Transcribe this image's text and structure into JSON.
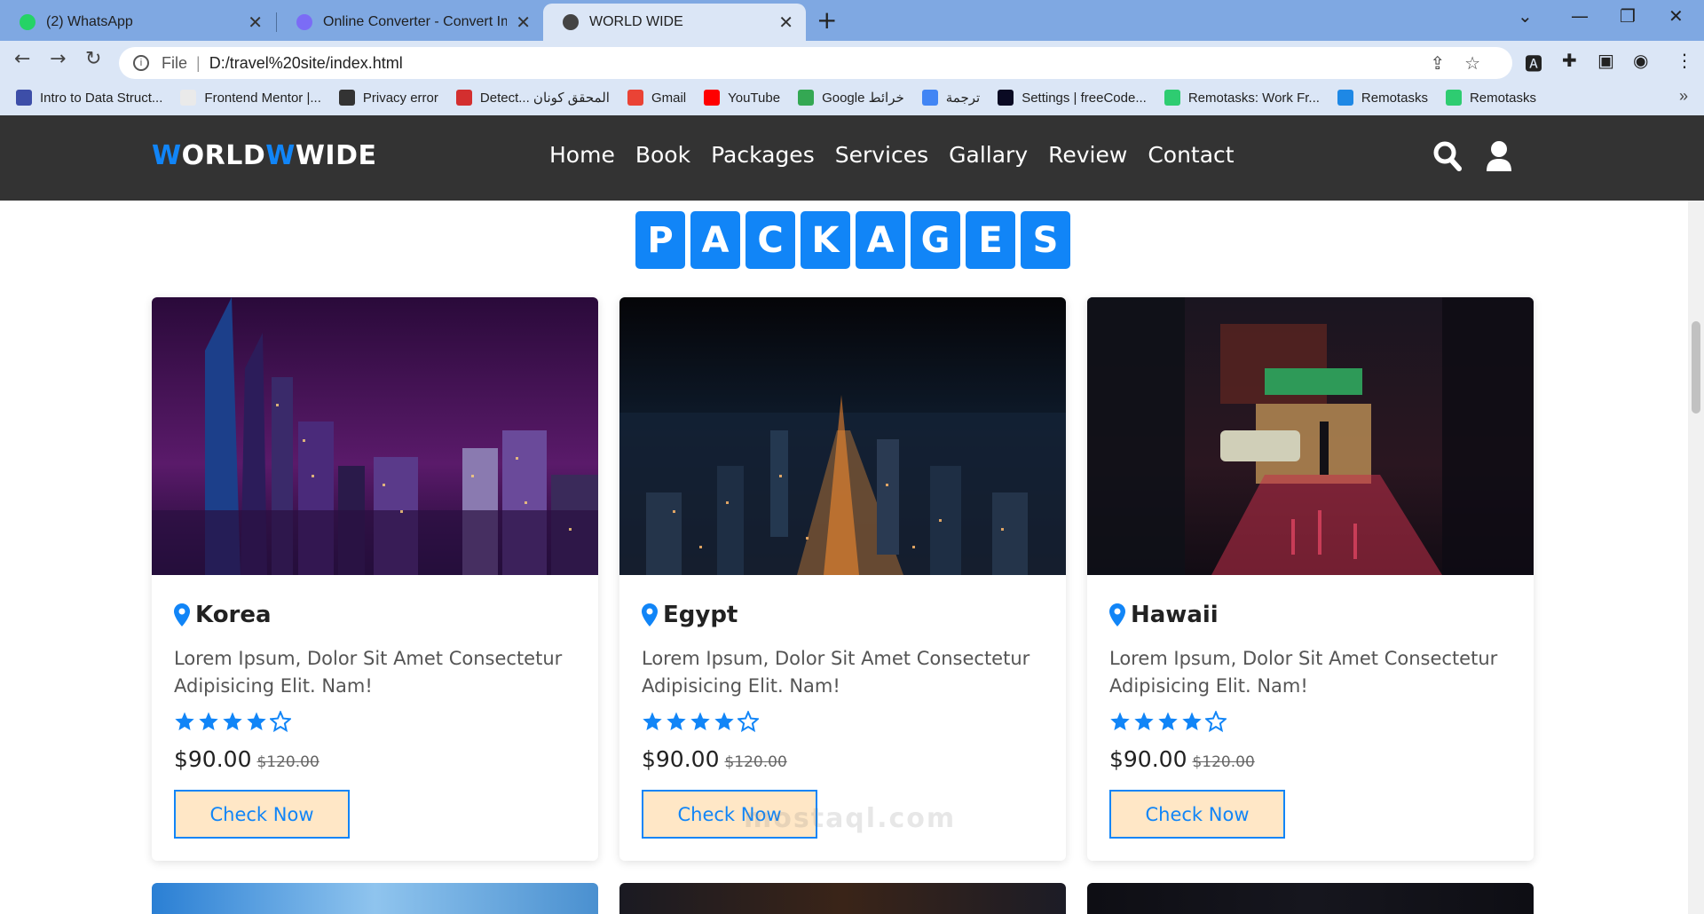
{
  "browser": {
    "tabs": [
      {
        "title": "(2) WhatsApp",
        "active": false,
        "color": "#25d366"
      },
      {
        "title": "Online Converter - Convert Imag",
        "active": false,
        "color": "#7b6cf6"
      },
      {
        "title": "WORLD WIDE",
        "active": true,
        "color": "#444444"
      }
    ],
    "address": {
      "scheme": "File",
      "url": "D:/travel%20site/index.html"
    },
    "bookmarks": [
      {
        "label": "Intro to Data Struct...",
        "color": "#3d4ea8"
      },
      {
        "label": "Frontend Mentor |...",
        "color": "#eaeaea"
      },
      {
        "label": "Privacy error",
        "color": "#333333"
      },
      {
        "label": "Detect... المحقق كونان",
        "color": "#d32f2f"
      },
      {
        "label": "Gmail",
        "color": "#ea4335"
      },
      {
        "label": "YouTube",
        "color": "#ff0000"
      },
      {
        "label": "Google خرائط",
        "color": "#34a853"
      },
      {
        "label": "ترجمة",
        "color": "#4285f4"
      },
      {
        "label": "Settings | freeCode...",
        "color": "#0a0a23"
      },
      {
        "label": "Remotasks: Work Fr...",
        "color": "#2ecc71"
      },
      {
        "label": "Remotasks",
        "color": "#1e88e5"
      },
      {
        "label": "Remotasks",
        "color": "#2ecc71"
      }
    ]
  },
  "site": {
    "logo": {
      "parts": [
        "W",
        "ORLD",
        "W",
        "WIDE"
      ]
    },
    "nav": [
      "Home",
      "Book",
      "Packages",
      "Services",
      "Gallary",
      "Review",
      "Contact"
    ],
    "heading_letters": [
      "P",
      "A",
      "C",
      "K",
      "A",
      "G",
      "E",
      "S"
    ],
    "accent": "#1185f7",
    "packages": [
      {
        "place": "Korea",
        "desc": "Lorem Ipsum, Dolor Sit Amet Consectetur Adipisicing Elit. Nam!",
        "rating": 4,
        "price": "$90.00",
        "old_price": "$120.00",
        "button": "Check Now"
      },
      {
        "place": "Egypt",
        "desc": "Lorem Ipsum, Dolor Sit Amet Consectetur Adipisicing Elit. Nam!",
        "rating": 4,
        "price": "$90.00",
        "old_price": "$120.00",
        "button": "Check Now"
      },
      {
        "place": "Hawaii",
        "desc": "Lorem Ipsum, Dolor Sit Amet Consectetur Adipisicing Elit. Nam!",
        "rating": 4,
        "price": "$90.00",
        "old_price": "$120.00",
        "button": "Check Now"
      }
    ],
    "watermark": "mostaql.com"
  }
}
